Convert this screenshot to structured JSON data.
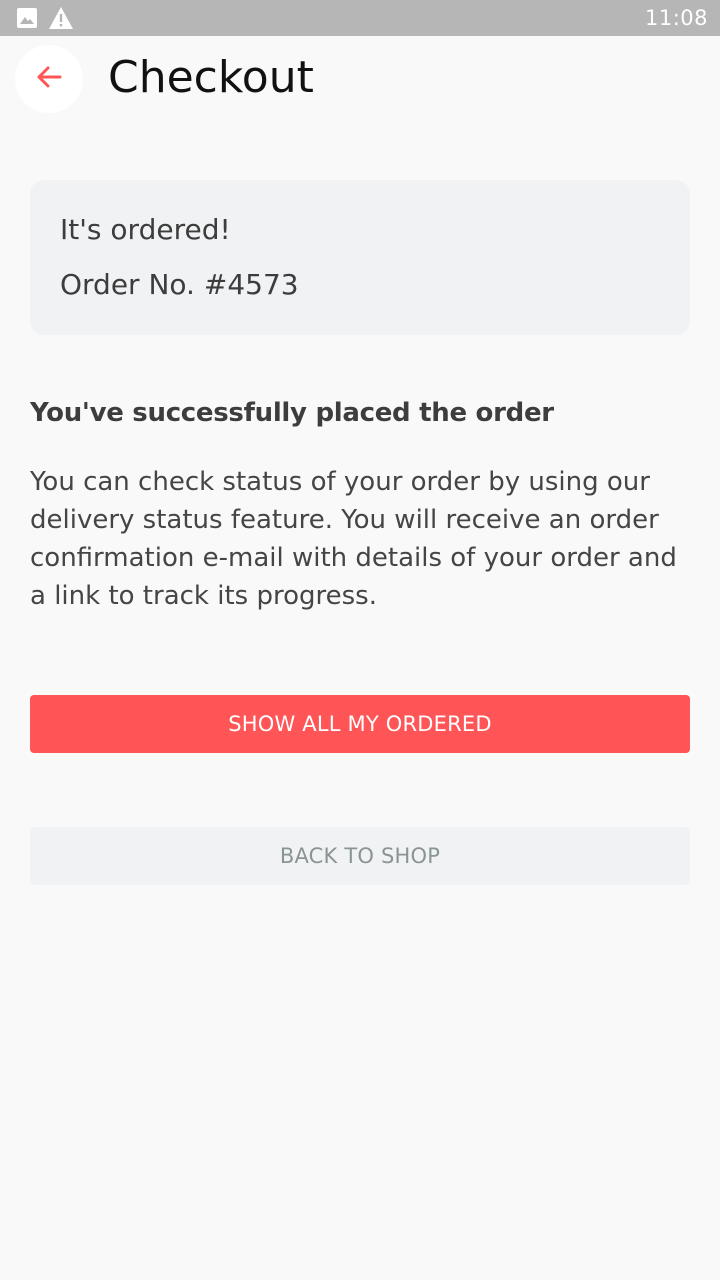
{
  "status_bar": {
    "time": "11:08",
    "icons": [
      "image-icon",
      "warning-icon"
    ]
  },
  "header": {
    "title": "Checkout",
    "back_icon": "arrow-left-icon"
  },
  "order_card": {
    "status": "It's ordered!",
    "order_number": "Order No. #4573"
  },
  "message": {
    "heading": "You've successfully placed the order",
    "body": "You can check status of your order by using our delivery status feature. You will receive an order confirmation e-mail with details of your order and a link to track its progress."
  },
  "actions": {
    "primary_label": "SHOW ALL MY ORDERED",
    "secondary_label": "BACK TO SHOP"
  },
  "colors": {
    "accent": "#ff5557",
    "status_bar": "#b6b6b6",
    "card_bg": "#f1f2f4",
    "page_bg": "#f9f9f9"
  }
}
